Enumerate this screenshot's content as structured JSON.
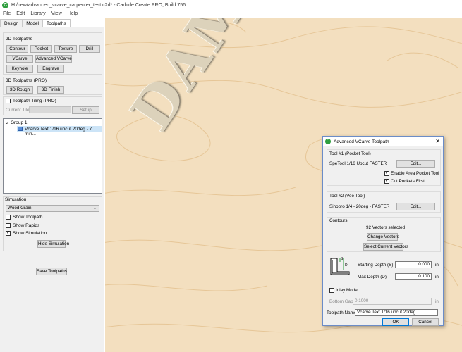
{
  "window": {
    "title": "H:/new/advanced_vcarve_carpenter_test.c2d* - Carbide Create PRO, Build 756"
  },
  "menu": [
    "File",
    "Edit",
    "Library",
    "View",
    "Help"
  ],
  "tabs": [
    "Design",
    "Model",
    "Toolpaths"
  ],
  "toolpaths_2d": {
    "heading": "2D Toolpaths",
    "buttons": [
      "Contour",
      "Pocket",
      "Texture",
      "Drill",
      "VCarve",
      "Advanced VCarve",
      "Keyhole",
      "Engrave"
    ]
  },
  "toolpaths_3d": {
    "heading": "3D Toolpaths (PRO)",
    "buttons": [
      "3D Rough",
      "3D Finish"
    ]
  },
  "tiling": {
    "label": "Toolpath Tiling (PRO)",
    "current_tile": "Current Tile",
    "setup": "Setup"
  },
  "tree": {
    "group": "Group 1",
    "item": "Vcarve Text 1/16 upcut 20deg - 7 min..."
  },
  "simulation": {
    "heading": "Simulation",
    "material": "Wood Grain",
    "show_toolpath": "Show Toolpath",
    "show_rapids": "Show Rapids",
    "show_simulation": "Show Simulation",
    "hide_button": "Hide Simulation"
  },
  "save_button": "Save Toolpaths",
  "dialog": {
    "title": "Advanced VCarve Toolpath",
    "tool1_heading": "Tool #1 (Pocket Tool)",
    "tool1_name": "SpeTool 1/16 Upcut FASTER",
    "edit": "Edit...",
    "enable_area": "Enable Area Pocket Tool",
    "cut_pockets": "Cut Pockets First",
    "tool2_heading": "Tool #2 (Vee Tool)",
    "tool2_name": "Sinopro 1/4 - 20deg - FASTER",
    "contours_heading": "Contours",
    "vectors_selected": "92 Vectors selected",
    "change_vectors": "Change Vectors",
    "select_current": "Select Current Vectors",
    "starting_depth_label": "Starting Depth (S)",
    "starting_depth": "0.000",
    "max_depth_label": "Max Depth (D)",
    "max_depth": "0.100",
    "unit": "in",
    "inlay_mode": "Inlay Mode",
    "bottom_gap_label": "Bottom Gap",
    "bottom_gap": "0.1000",
    "toolpath_name_label": "Toolpath Name",
    "toolpath_name": "Vcarve Text 1/16 upcut 20deg",
    "ok": "OK",
    "cancel": "Cancel",
    "diagram_s": "S",
    "diagram_d": "D"
  },
  "canvas_text": "DAMIAN",
  "colors": {
    "wood": "#f3dfbf",
    "grain": "#e8c99a",
    "carve": "#d9cfb8",
    "accent": "#2e9e3e"
  }
}
